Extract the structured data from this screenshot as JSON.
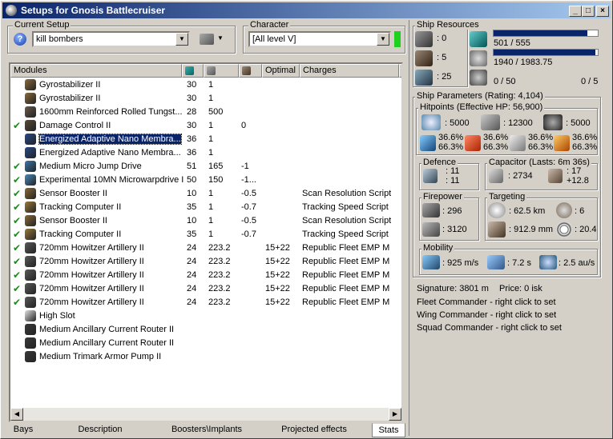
{
  "window": {
    "title": "Setups for Gnosis Battlecruiser"
  },
  "current_setup": {
    "label": "Current Setup",
    "value": "kill bombers"
  },
  "character": {
    "label": "Character",
    "value": "[All level V]"
  },
  "columns": [
    "Modules",
    "",
    "",
    "",
    "Optimal",
    "Charges",
    "H"
  ],
  "modules": [
    {
      "checked": false,
      "name": "Gyrostabilizer II",
      "c1": "30",
      "c2": "1",
      "c3": "",
      "optimal": "",
      "charges": "",
      "icon": "gyrostabilizer-icon",
      "color": "#8a6a3a"
    },
    {
      "checked": false,
      "name": "Gyrostabilizer II",
      "c1": "30",
      "c2": "1",
      "c3": "",
      "optimal": "",
      "charges": "",
      "icon": "gyrostabilizer-icon",
      "color": "#8a6a3a"
    },
    {
      "checked": false,
      "name": "1600mm Reinforced Rolled Tungst...",
      "c1": "28",
      "c2": "500",
      "c3": "",
      "optimal": "",
      "charges": "",
      "icon": "armor-plate-icon",
      "color": "#6a5a4a"
    },
    {
      "checked": true,
      "name": "Damage Control II",
      "c1": "30",
      "c2": "1",
      "c3": "0",
      "optimal": "",
      "charges": "",
      "icon": "damage-control-icon",
      "color": "#5a4a3a"
    },
    {
      "checked": false,
      "name": "Energized Adaptive Nano Membra...",
      "c1": "36",
      "c2": "1",
      "c3": "",
      "optimal": "",
      "charges": "",
      "icon": "membrane-icon",
      "color": "#2a4a8a",
      "selected": true
    },
    {
      "checked": false,
      "name": "Energized Adaptive Nano Membra...",
      "c1": "36",
      "c2": "1",
      "c3": "",
      "optimal": "",
      "charges": "",
      "icon": "membrane-icon",
      "color": "#2a4a8a"
    },
    {
      "checked": true,
      "name": "Medium Micro Jump Drive",
      "c1": "51",
      "c2": "165",
      "c3": "-1",
      "optimal": "",
      "charges": "",
      "icon": "jump-drive-icon",
      "color": "#3a7aaa"
    },
    {
      "checked": true,
      "name": "Experimental 10MN Microwarpdrive I",
      "c1": "50",
      "c2": "150",
      "c3": "-1...",
      "optimal": "",
      "charges": "",
      "icon": "microwarpdrive-icon",
      "color": "#4a8aba"
    },
    {
      "checked": true,
      "name": "Sensor Booster II",
      "c1": "10",
      "c2": "1",
      "c3": "-0.5",
      "optimal": "",
      "charges": "Scan Resolution Script",
      "icon": "sensor-booster-icon",
      "color": "#8a6a3a"
    },
    {
      "checked": true,
      "name": "Tracking Computer II",
      "c1": "35",
      "c2": "1",
      "c3": "-0.7",
      "optimal": "",
      "charges": "Tracking Speed Script",
      "icon": "tracking-computer-icon",
      "color": "#9a7a3a"
    },
    {
      "checked": true,
      "name": "Sensor Booster II",
      "c1": "10",
      "c2": "1",
      "c3": "-0.5",
      "optimal": "",
      "charges": "Scan Resolution Script",
      "icon": "sensor-booster-icon",
      "color": "#8a6a3a"
    },
    {
      "checked": true,
      "name": "Tracking Computer II",
      "c1": "35",
      "c2": "1",
      "c3": "-0.7",
      "optimal": "",
      "charges": "Tracking Speed Script",
      "icon": "tracking-computer-icon",
      "color": "#9a7a3a"
    },
    {
      "checked": true,
      "name": "720mm Howitzer Artillery II",
      "c1": "24",
      "c2": "223.2",
      "c3": "",
      "optimal": "15+22",
      "charges": "Republic Fleet EMP M",
      "icon": "artillery-icon",
      "color": "#5a5a5a"
    },
    {
      "checked": true,
      "name": "720mm Howitzer Artillery II",
      "c1": "24",
      "c2": "223.2",
      "c3": "",
      "optimal": "15+22",
      "charges": "Republic Fleet EMP M",
      "icon": "artillery-icon",
      "color": "#5a5a5a"
    },
    {
      "checked": true,
      "name": "720mm Howitzer Artillery II",
      "c1": "24",
      "c2": "223.2",
      "c3": "",
      "optimal": "15+22",
      "charges": "Republic Fleet EMP M",
      "icon": "artillery-icon",
      "color": "#5a5a5a"
    },
    {
      "checked": true,
      "name": "720mm Howitzer Artillery II",
      "c1": "24",
      "c2": "223.2",
      "c3": "",
      "optimal": "15+22",
      "charges": "Republic Fleet EMP M",
      "icon": "artillery-icon",
      "color": "#5a5a5a"
    },
    {
      "checked": true,
      "name": "720mm Howitzer Artillery II",
      "c1": "24",
      "c2": "223.2",
      "c3": "",
      "optimal": "15+22",
      "charges": "Republic Fleet EMP M",
      "icon": "artillery-icon",
      "color": "#5a5a5a"
    },
    {
      "checked": false,
      "name": "High Slot",
      "c1": "",
      "c2": "",
      "c3": "",
      "optimal": "",
      "charges": "",
      "icon": "high-slot-icon",
      "color": "#e0e0e0"
    },
    {
      "checked": false,
      "name": "Medium Ancillary Current Router II",
      "c1": "",
      "c2": "",
      "c3": "",
      "optimal": "",
      "charges": "",
      "icon": "rig-icon",
      "color": "#3a3a3a"
    },
    {
      "checked": false,
      "name": "Medium Ancillary Current Router II",
      "c1": "",
      "c2": "",
      "c3": "",
      "optimal": "",
      "charges": "",
      "icon": "rig-icon",
      "color": "#3a3a3a"
    },
    {
      "checked": false,
      "name": "Medium Trimark Armor Pump II",
      "c1": "",
      "c2": "",
      "c3": "",
      "optimal": "",
      "charges": "",
      "icon": "rig-icon",
      "color": "#3a3a3a"
    }
  ],
  "tabs": [
    "Bays",
    "Description",
    "Boosters\\Implants",
    "Projected effects",
    "Stats"
  ],
  "ship_resources": {
    "label": "Ship Resources",
    "turret": ": 0",
    "launcher": ": 5",
    "drone": ": 25",
    "cpu": "501 / 555",
    "cpu_fraction": 0.903,
    "powergrid": "1940 / 1983.75",
    "powergrid_fraction": 0.978,
    "calibration": "0 / 50",
    "drone_bay": "0 / 5"
  },
  "ship_parameters": {
    "label": "Ship Parameters (Rating: 4,104)",
    "hitpoints_label": "Hitpoints (Effective HP: 56,900)",
    "shield_hp": ": 5000",
    "armor_hp": ": 12300",
    "structure_hp": ": 5000",
    "resists": [
      {
        "a": "36.6%",
        "b": "66.3%"
      },
      {
        "a": "36.6%",
        "b": "66.3%"
      },
      {
        "a": "36.6%",
        "b": "66.3%"
      },
      {
        "a": "36.6%",
        "b": "66.3%"
      }
    ],
    "defence_label": "Defence",
    "defence_1": ": 11",
    "defence_2": ": 11",
    "capacitor_label": "Capacitor (Lasts: 6m 36s)",
    "capacitor_amount": ": 2734",
    "capacitor_recharge_1": ": 17",
    "capacitor_recharge_2": "+12.8",
    "firepower_label": "Firepower",
    "dps": ": 296",
    "volley": ": 3120",
    "targeting_label": "Targeting",
    "target_range": ": 62.5 km",
    "max_targets": ": 6",
    "scan_res": ": 912.9 mm",
    "sensor_strength": ": 20.4",
    "mobility_label": "Mobility",
    "speed": ": 925 m/s",
    "align": ": 7.2 s",
    "warp": ": 2.5 au/s",
    "signature": "Signature: 3801 m",
    "price": "Price: 0 isk",
    "fleet_commander": "Fleet Commander - right click to set",
    "wing_commander": "Wing Commander - right click to set",
    "squad_commander": "Squad Commander - right click to set"
  }
}
